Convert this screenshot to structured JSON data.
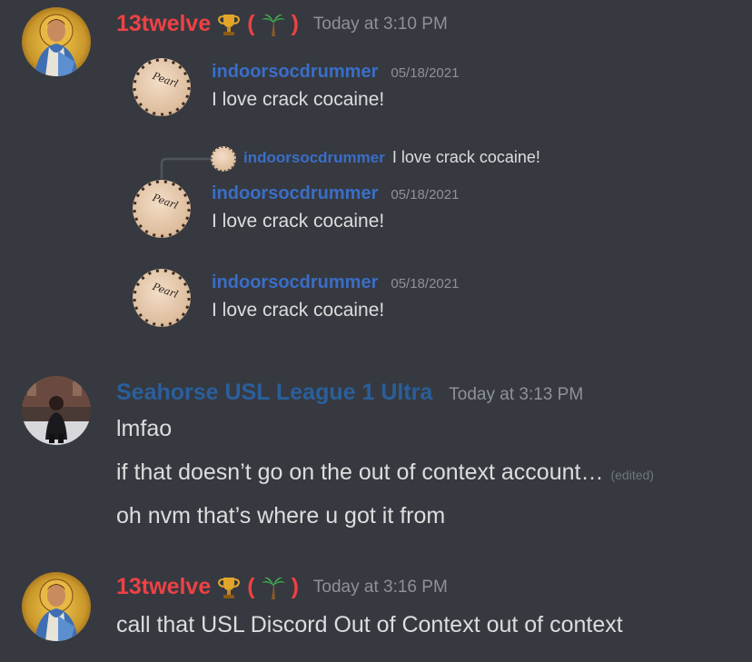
{
  "messages": [
    {
      "author": "13twelve",
      "badges": [
        "trophy-icon",
        "palm-tree-icon"
      ],
      "timestamp": "Today at 3:10 PM",
      "quotes": [
        {
          "author": "indoorsocdrummer",
          "date": "05/18/2021",
          "text": "I love crack cocaine!"
        },
        {
          "reply_to_author": "indoorsocdrummer",
          "reply_to_text": "I love crack cocaine!",
          "author": "indoorsocdrummer",
          "date": "05/18/2021",
          "text": "I love crack cocaine!"
        },
        {
          "author": "indoorsocdrummer",
          "date": "05/18/2021",
          "text": "I love crack cocaine!"
        }
      ]
    },
    {
      "author": "Seahorse USL League 1 Ultra",
      "timestamp": "Today at 3:13 PM",
      "lines": [
        {
          "text": "lmfao"
        },
        {
          "text": "if that doesn’t go on the out of context account…",
          "edited": "(edited)"
        },
        {
          "text": "oh nvm that’s where u got it from"
        }
      ]
    },
    {
      "author": "13twelve",
      "badges": [
        "trophy-icon",
        "palm-tree-icon"
      ],
      "timestamp": "Today at 3:16 PM",
      "lines": [
        {
          "text": "call that USL Discord Out of Context out of context"
        }
      ]
    }
  ],
  "colors": {
    "background": "#36393f",
    "name_red": "#ed4245",
    "name_blue": "#3a6ec8",
    "name_seahorse": "#2a5f9c",
    "timestamp": "#8e9297",
    "text": "#dcddde"
  }
}
